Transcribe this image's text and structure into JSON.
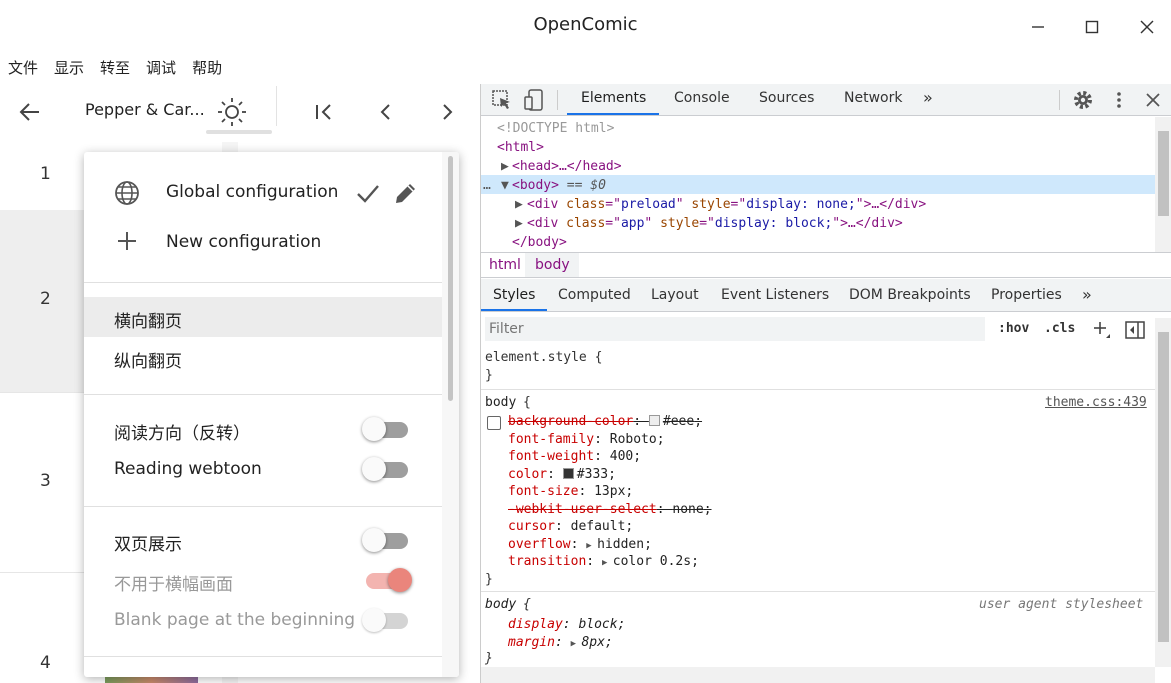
{
  "window": {
    "title": "OpenComic",
    "minimize_icon": "minimize-icon",
    "maximize_icon": "maximize-icon",
    "close_icon": "close-icon"
  },
  "menu": [
    "文件",
    "显示",
    "转至",
    "调试",
    "帮助"
  ],
  "toolbar": {
    "comic_title": "Pepper & Car..."
  },
  "thumbnails": [
    {
      "page": "1"
    },
    {
      "page": "2"
    },
    {
      "page": "3"
    },
    {
      "page": "4"
    }
  ],
  "popup": {
    "global_config": "Global configuration",
    "new_config": "New configuration",
    "horizontal": "横向翻页",
    "vertical": "纵向翻页",
    "reading_direction": "阅读方向（反转）",
    "reading_webtoon": "Reading webtoon",
    "double_page": "双页展示",
    "not_for_landscape": "不用于横幅画面",
    "blank_page": "Blank page at the beginning",
    "toggles": {
      "reading_direction": false,
      "reading_webtoon": false,
      "double_page": false,
      "not_for_landscape": true,
      "blank_page": false
    }
  },
  "devtools": {
    "tabs": [
      "Elements",
      "Console",
      "Sources",
      "Network"
    ],
    "active_tab": "Elements",
    "more": "»",
    "dom": {
      "doctype": "<!DOCTYPE html>",
      "html_open": "<html>",
      "head": "<head>…</head>",
      "body_eq": "== $0",
      "div1_class": "preload",
      "div1_style": "display: none;",
      "div2_class": "app",
      "div2_style": "display: block;",
      "body_close": "</body>"
    },
    "breadcrumbs": [
      "html",
      "body"
    ],
    "style_tabs": [
      "Styles",
      "Computed",
      "Layout",
      "Event Listeners",
      "DOM Breakpoints",
      "Properties"
    ],
    "style_more": "»",
    "filter_placeholder": "Filter",
    "hov": ":hov",
    "cls": ".cls",
    "element_style": "element.style {",
    "close_brace": "}",
    "body_rule": {
      "selector": "body",
      "source": "theme.css:439",
      "props": [
        {
          "name": "background-color",
          "value": "#eee",
          "struck": true,
          "swatch": "#eeeeee"
        },
        {
          "name": "font-family",
          "value": "Roboto"
        },
        {
          "name": "font-weight",
          "value": "400"
        },
        {
          "name": "color",
          "value": "#333",
          "swatch": "#333333"
        },
        {
          "name": "font-size",
          "value": "13px"
        },
        {
          "name": "-webkit-user-select",
          "value": "none",
          "struck": true
        },
        {
          "name": "cursor",
          "value": "default"
        },
        {
          "name": "overflow",
          "value": "hidden",
          "arrow": true
        },
        {
          "name": "transition",
          "value": "color 0.2s",
          "arrow": true
        }
      ]
    },
    "ua_rule": {
      "selector": "body",
      "source": "user agent stylesheet",
      "props": [
        {
          "name": "display",
          "value": "block"
        },
        {
          "name": "margin",
          "value": "8px",
          "arrow": true
        }
      ]
    }
  },
  "colors": {
    "accent_blue": "#1a73e8",
    "toggle_on": "#ea857c",
    "selected_dom": "#cfe8fc"
  }
}
